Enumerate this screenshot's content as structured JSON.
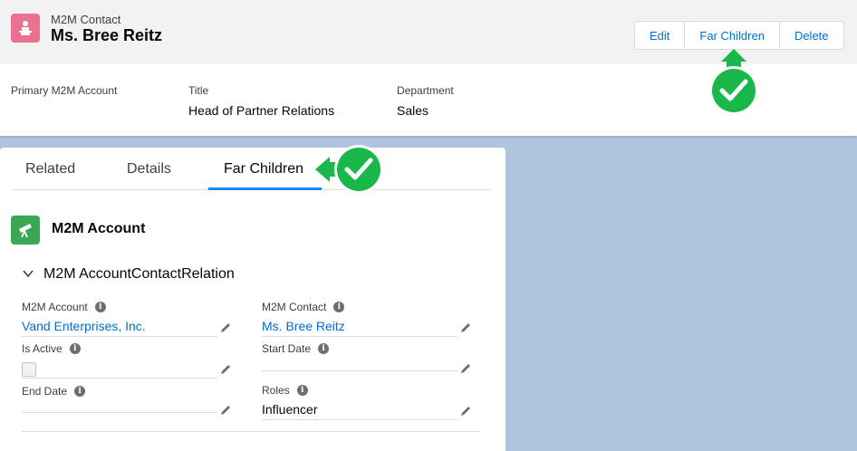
{
  "header": {
    "object_label": "M2M Contact",
    "record_name": "Ms. Bree Reitz",
    "actions": [
      "Edit",
      "Far Children",
      "Delete"
    ]
  },
  "highlights": [
    {
      "label": "Primary M2M Account",
      "value": ""
    },
    {
      "label": "Title",
      "value": "Head of Partner Relations"
    },
    {
      "label": "Department",
      "value": "Sales"
    }
  ],
  "tabs": [
    {
      "label": "Related"
    },
    {
      "label": "Details"
    },
    {
      "label": "Far Children",
      "active": true
    }
  ],
  "related_list": {
    "title": "M2M Account",
    "section_title": "M2M AccountContactRelation",
    "fields": {
      "account": {
        "label": "M2M Account",
        "value": "Vand Enterprises, Inc."
      },
      "contact": {
        "label": "M2M Contact",
        "value": "Ms. Bree Reitz"
      },
      "is_active": {
        "label": "Is Active",
        "value": ""
      },
      "start_date": {
        "label": "Start Date",
        "value": ""
      },
      "end_date": {
        "label": "End Date",
        "value": ""
      },
      "roles": {
        "label": "Roles",
        "value": "Influencer"
      }
    }
  },
  "colors": {
    "object_icon": "#eb7092",
    "related_icon": "#3ba755",
    "link": "#006dcc",
    "callout_green": "#1ab84a"
  }
}
